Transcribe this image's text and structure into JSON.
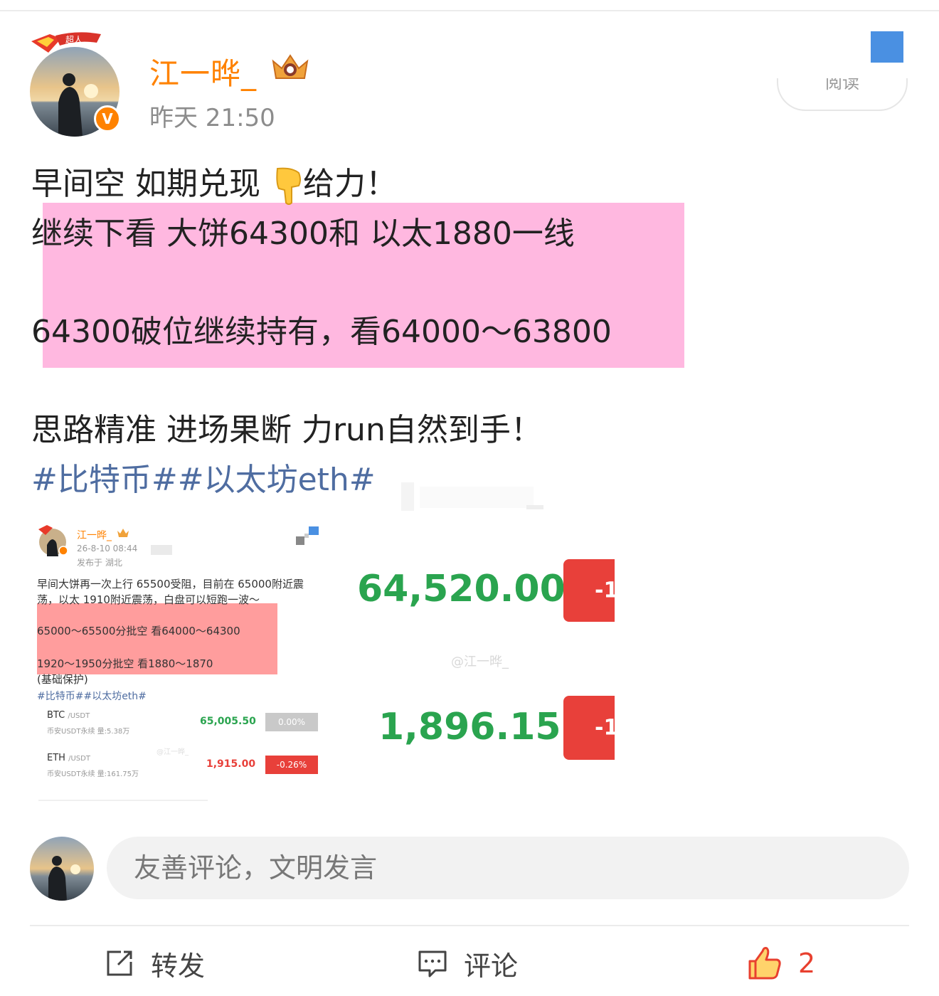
{
  "post": {
    "author": "江一晔_",
    "time": "昨天 21:50",
    "read_label": "阅读",
    "badge_label": "超人",
    "verified_mark": "V",
    "lines": [
      "早间空 如期兑现 ",
      "给力！",
      "继续下看  大饼64300和 以太1880一线",
      "64300破位继续持有，看64000～63800",
      "思路精准 进场果断 力run自然到手！"
    ],
    "hashtags": "#比特币##以太坊eth#",
    "highlight_color": "#ffb8e0"
  },
  "embedded": {
    "author": "江一晔_",
    "time": "26-8-10 08:44",
    "location": "发布于 湖北",
    "text_lines": [
      "早间大饼再一次上行 65500受阻，目前在 65000附近震",
      "荡，以太 1910附近震荡，白盘可以短跑一波～",
      "65000～65500分批空 看64000～64300",
      "1920～1950分批空 看1880～1870",
      "(基础保护)"
    ],
    "hashtags": "#比特币##以太坊eth#",
    "watermark_small": "@江一晔_",
    "tickers": [
      {
        "symbol": "BTC",
        "quote": "/USDT",
        "sub": "币安USDT永续 量:5.38万",
        "price": "65,005.50",
        "change": "0.00%",
        "change_color": "#c9c9c9",
        "price_color": "#2aa44f"
      },
      {
        "symbol": "ETH",
        "quote": "/USDT",
        "sub": "币安USDT永续 量:161.75万",
        "price": "1,915.00",
        "change": "-0.26%",
        "change_color": "#e8403a",
        "price_color": "#e8403a"
      }
    ],
    "big_prices": [
      "64,520.00",
      "1,896.15"
    ],
    "red_block_text": "-1",
    "watermark": "@江一晔_"
  },
  "comment": {
    "placeholder": "友善评论，文明发言"
  },
  "actions": {
    "repost": "转发",
    "comment": "评论",
    "like_count": "2"
  },
  "colors": {
    "accent_orange": "#ff8200",
    "hashtag_blue": "#4f6da1",
    "like_red": "#e8402f",
    "corner_blue": "#4a90e2"
  }
}
